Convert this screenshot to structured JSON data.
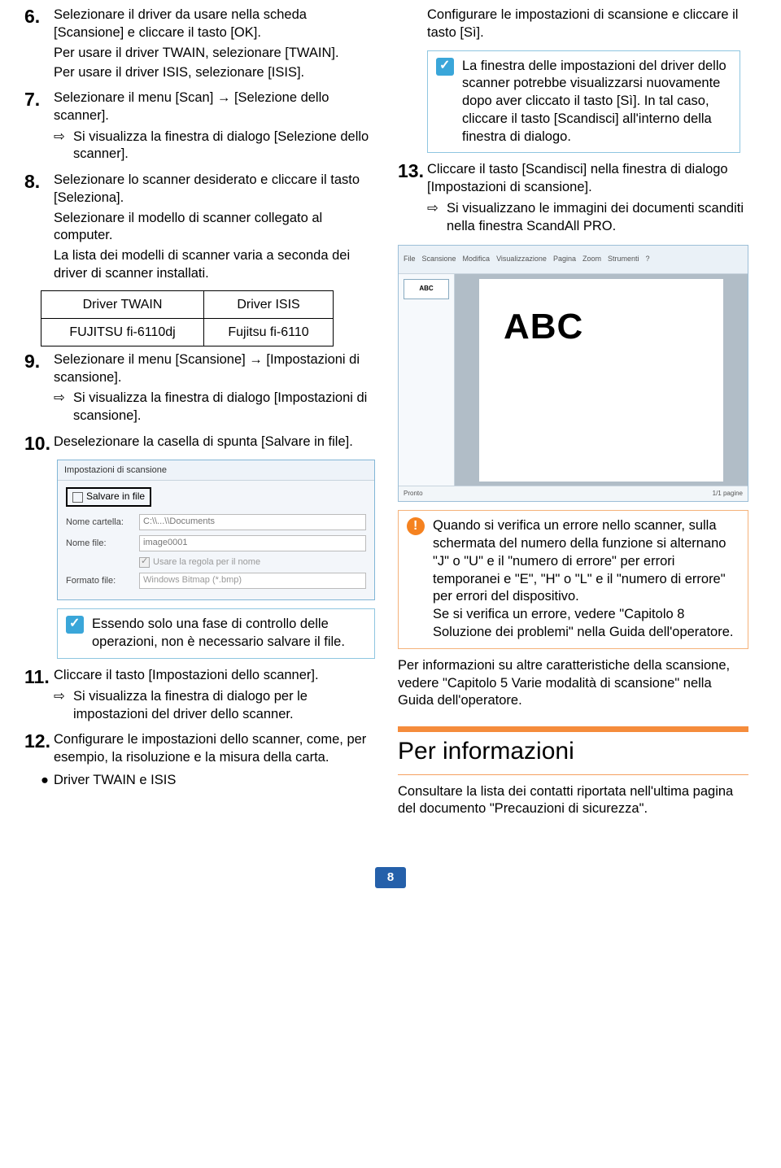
{
  "left": {
    "s6": {
      "num": "6.",
      "a": "Selezionare il driver da usare nella scheda [Scansione] e cliccare il tasto [OK].",
      "b": "Per usare il driver TWAIN, selezionare [TWAIN].",
      "c": "Per usare il driver ISIS, selezionare [ISIS]."
    },
    "s7": {
      "num": "7.",
      "a": "Selezionare il menu [Scan] → [Selezione dello scanner].",
      "arrow": "Si visualizza la finestra di dialogo [Selezione dello scanner]."
    },
    "s8": {
      "num": "8.",
      "a": "Selezionare lo scanner desiderato e cliccare il tasto [Seleziona].",
      "b": "Selezionare il modello di scanner collegato al computer.",
      "c": "La lista dei modelli di scanner varia a seconda dei driver di scanner installati."
    },
    "table": {
      "h1": "Driver TWAIN",
      "h2": "Driver ISIS",
      "c1": "FUJITSU fi-6110dj",
      "c2": "Fujitsu fi-6110"
    },
    "s9": {
      "num": "9.",
      "a": "Selezionare il menu [Scansione] → [Impostazioni di scansione].",
      "arrow": "Si visualizza la finestra di dialogo [Impostazioni di scansione]."
    },
    "s10": {
      "num": "10.",
      "a": "Deselezionare la casella di spunta [Salvare in file]."
    },
    "shot1": {
      "title": "Impostazioni di scansione",
      "cb": "Salvare in file",
      "l1": "Nome cartella:",
      "v1": "C:\\\\...\\\\Documents",
      "l2": "Nome file:",
      "v2": "image0001",
      "l3_cb": "Usare la regola per il nome",
      "l4": "Formato file:",
      "v4": "Windows Bitmap (*.bmp)"
    },
    "note1": "Essendo solo una fase di controllo delle operazioni, non è necessario salvare il file.",
    "s11": {
      "num": "11.",
      "a": "Cliccare il tasto [Impostazioni dello scanner].",
      "arrow": "Si visualizza la finestra di dialogo per le impostazioni del driver dello scanner."
    },
    "s12": {
      "num": "12.",
      "a": "Configurare le impostazioni dello scanner, come, per esempio, la risoluzione e la misura della carta."
    },
    "bul": "Driver TWAIN e ISIS"
  },
  "right": {
    "cont": "Configurare le impostazioni di scansione e cliccare il tasto [Sì].",
    "note2": "La finestra delle impostazioni del driver dello scanner potrebbe visualizzarsi nuovamente dopo aver cliccato il tasto [Sì]. In tal caso, cliccare il tasto [Scandisci] all'interno della finestra di dialogo.",
    "s13": {
      "num": "13.",
      "a": "Cliccare il tasto [Scandisci] nella finestra di dialogo [Impostazioni di scansione].",
      "arrow": "Si visualizzano le immagini dei documenti scanditi nella finestra ScandAll PRO."
    },
    "abc": "ABC",
    "thumbABC": "ABC",
    "rs_status_l": "Pronto",
    "rs_status_r": "1/1 pagine",
    "warn": "Quando si verifica un errore nello scanner, sulla schermata del numero della funzione si alternano \"J\" o \"U\" e il \"numero di errore\" per errori temporanei e \"E\", \"H\" o \"L\" e il \"numero di errore\" per errori del dispositivo.\nSe si verifica un errore, vedere \"Capitolo 8 Soluzione dei problemi\" nella Guida dell'operatore.",
    "para1": "Per informazioni su altre caratteristiche della scansione, vedere \"Capitolo 5 Varie modalità di scansione\" nella Guida dell'operatore.",
    "h2": "Per informazioni",
    "para2": "Consultare la lista dei contatti riportata nell'ultima pagina del documento \"Precauzioni di sicurezza\"."
  },
  "page": "8"
}
